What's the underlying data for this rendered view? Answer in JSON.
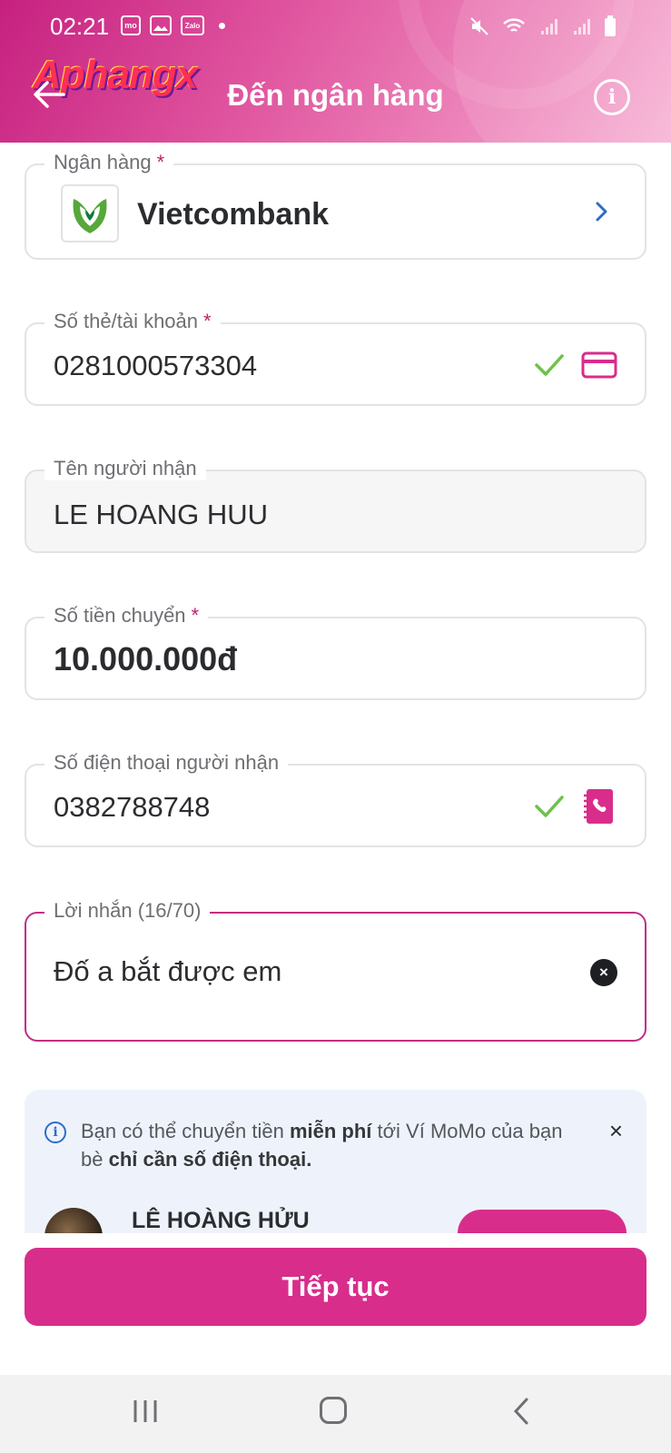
{
  "status_bar": {
    "time": "02:21",
    "zalo_label": "Zalo",
    "momo_label": "mo"
  },
  "header": {
    "watermark": "Aphangx",
    "title": "Đến ngân hàng",
    "info_icon": "i"
  },
  "bank_field": {
    "label": "Ngân hàng",
    "required_mark": "*",
    "value": "Vietcombank"
  },
  "account_field": {
    "label": "Số thẻ/tài khoản",
    "required_mark": "*",
    "value": "0281000573304"
  },
  "name_field": {
    "label": "Tên người nhận",
    "value": "LE HOANG HUU"
  },
  "amount_field": {
    "label": "Số tiền chuyển",
    "required_mark": "*",
    "value": "10.000.000đ"
  },
  "phone_field": {
    "label": "Số điện thoại người nhận",
    "value": "0382788748"
  },
  "message_field": {
    "label": "Lời nhắn (16/70)",
    "value": "Đố a bắt được em",
    "clear_icon": "×"
  },
  "banner": {
    "icon": "i",
    "text_before": "Bạn có thể chuyển tiền ",
    "text_bold1": "miễn phí",
    "text_middle": " tới Ví MoMo của bạn bè ",
    "text_bold2": "chỉ cần số điện thoại.",
    "close": "×",
    "suggest_name": "LÊ HOÀNG HỬU"
  },
  "continue_button": {
    "label": "Tiếp tục"
  },
  "colors": {
    "brand": "#d82d8b",
    "success": "#6ec14a",
    "link": "#2f6cc8"
  },
  "icons": [
    "back-arrow-icon",
    "info-icon",
    "vietcombank-logo-icon",
    "chevron-right-icon",
    "check-icon",
    "card-icon",
    "contact-book-icon",
    "clear-icon",
    "close-icon",
    "nav-recent-icon",
    "nav-home-icon",
    "nav-back-icon"
  ]
}
